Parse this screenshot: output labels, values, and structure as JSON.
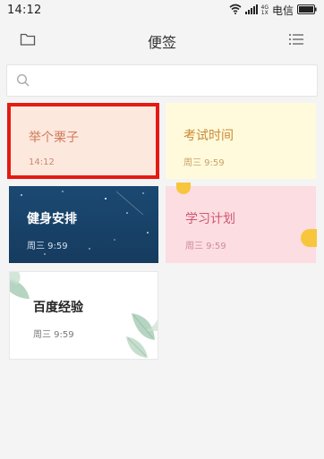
{
  "status_bar": {
    "time": "14:12",
    "net_top": "4G",
    "net_bottom": "1X",
    "carrier": "电信",
    "icons": [
      "wifi-icon",
      "signal-icon",
      "battery-icon"
    ]
  },
  "header": {
    "title": "便签",
    "left_icon": "folder-icon",
    "right_icon": "list-menu-icon"
  },
  "search": {
    "placeholder": "",
    "icon": "search-icon"
  },
  "notes": [
    {
      "title": "举个栗子",
      "time": "14:12",
      "theme": "peach",
      "selected": true,
      "highlight_color": "#e41a13"
    },
    {
      "title": "考试时间",
      "time": "周三 9:59",
      "theme": "light-yellow"
    },
    {
      "title": "健身安排",
      "time": "周三 9:59",
      "theme": "night-sky"
    },
    {
      "title": "学习计划",
      "time": "周三 9:59",
      "theme": "pink"
    },
    {
      "title": "百度经验",
      "time": "周三 9:59",
      "theme": "leaves"
    }
  ],
  "colors": {
    "background": "#f4f4f4",
    "selection_border": "#e41a13",
    "deco_yellow": "#f7c63c"
  }
}
